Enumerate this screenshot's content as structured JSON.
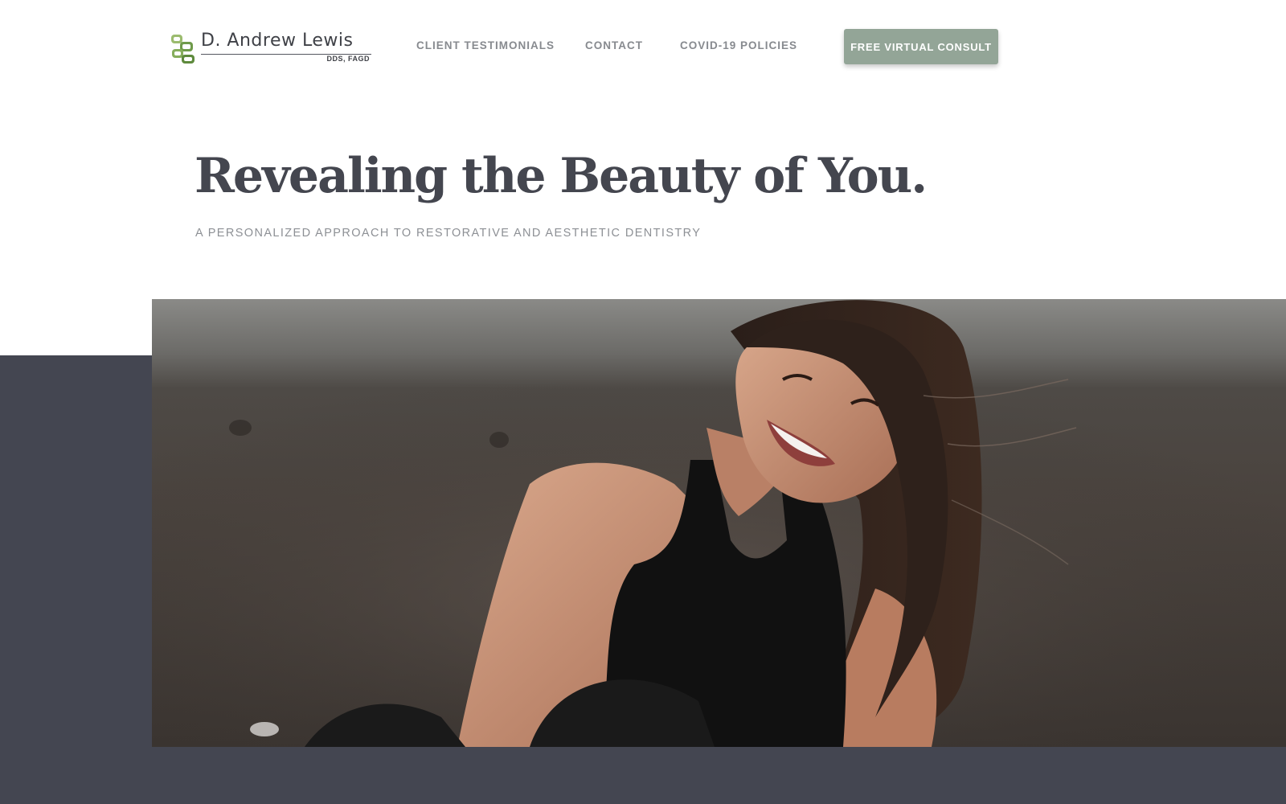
{
  "logo": {
    "name": "D. Andrew Lewis",
    "credentials": "DDS, FAGD",
    "icon": "tooth-chain-logo-icon"
  },
  "nav": {
    "items": [
      {
        "label": "CLIENT TESTIMONIALS"
      },
      {
        "label": "CONTACT"
      },
      {
        "label": "COVID-19 POLICIES"
      }
    ],
    "cta_label": "FREE VIRTUAL CONSULT"
  },
  "hero": {
    "title": "Revealing the Beauty of You.",
    "subtitle": "A PERSONALIZED APPROACH TO RESTORATIVE AND AESTHETIC DENTISTRY",
    "photo": "smiling-woman-photo"
  },
  "colors": {
    "accent": "#93a597",
    "dark_band": "#444651",
    "heading": "#44464f",
    "nav_text": "#878a8f",
    "logo_green": "#7aa05a"
  }
}
